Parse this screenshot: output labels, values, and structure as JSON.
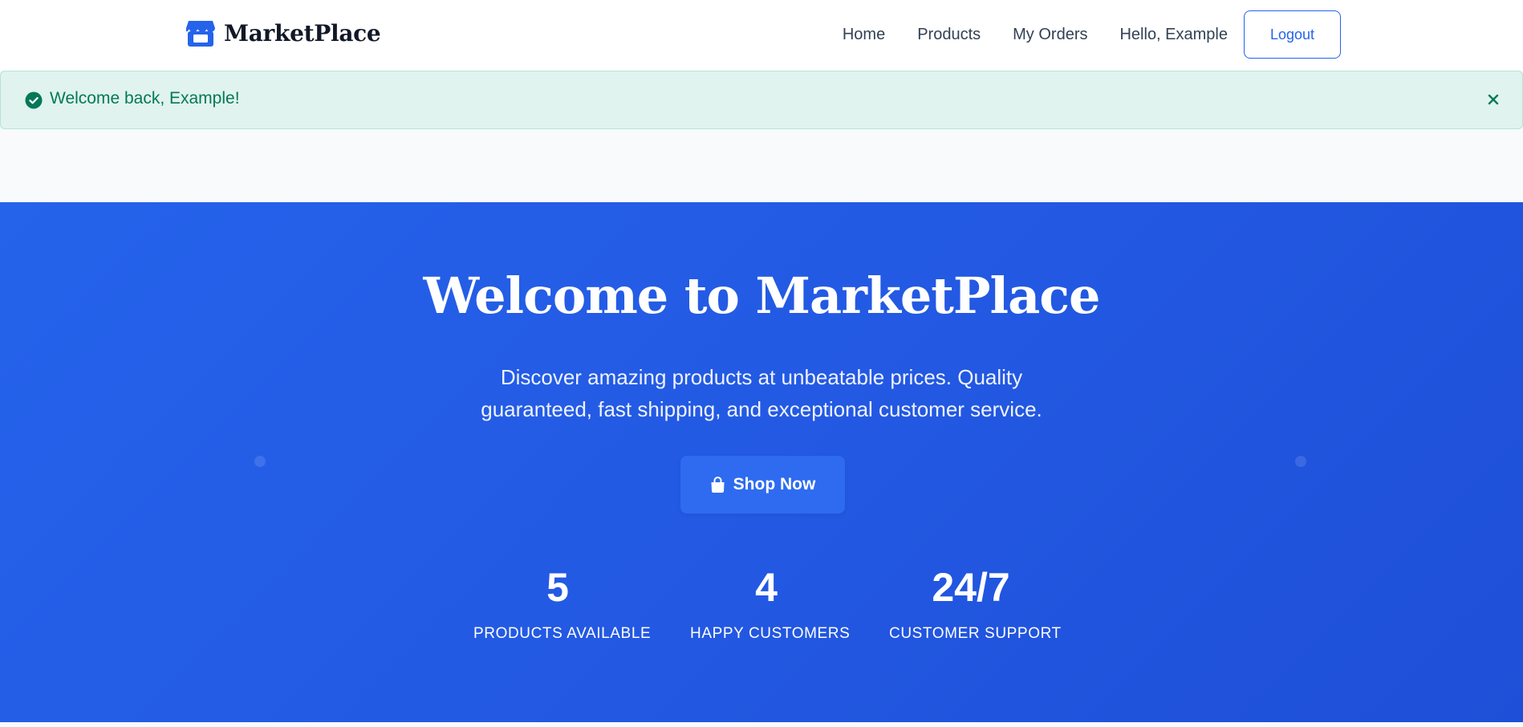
{
  "header": {
    "brand_name": "MarketPlace",
    "brand_icon": "store-icon",
    "nav": {
      "home": "Home",
      "products": "Products",
      "orders": "My Orders",
      "greeting": "Hello, Example",
      "logout": "Logout"
    }
  },
  "alert": {
    "icon": "check-circle-icon",
    "message": "Welcome back, Example!",
    "close_icon": "close-icon"
  },
  "hero": {
    "title": "Welcome to MarketPlace",
    "subtitle": "Discover amazing products at unbeatable prices. Quality guaranteed, fast shipping, and exceptional customer service.",
    "cta_label": "Shop Now",
    "cta_icon": "shopping-bag-icon",
    "stats": [
      {
        "value": "5",
        "label": "PRODUCTS AVAILABLE"
      },
      {
        "value": "4",
        "label": "HAPPY CUSTOMERS"
      },
      {
        "value": "24/7",
        "label": "CUSTOMER SUPPORT"
      }
    ]
  },
  "colors": {
    "primary": "#2563eb",
    "alert_bg": "#e0f3ee",
    "alert_text": "#047857"
  }
}
